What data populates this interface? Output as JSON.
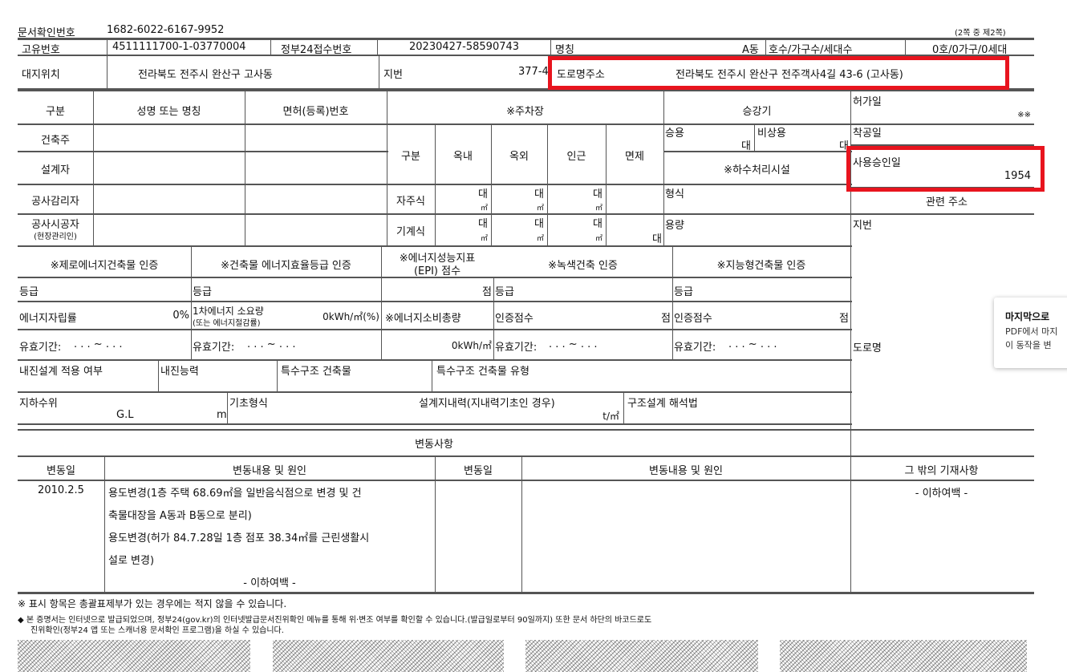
{
  "doc": {
    "doc_number_label": "문서확인번호",
    "doc_number": "1682-6022-6167-9952",
    "page_info": "(2쪽 중 제2쪽)"
  },
  "row1": {
    "unique_label": "고유번호",
    "unique_value": "4511111700-1-03770004",
    "gov24_label": "정부24접수번호",
    "gov24_value": "20230427-58590743",
    "name_label": "명칭",
    "name_value": "A동",
    "unit_label": "호수/가구수/세대수",
    "unit_value": "0호/0가구/0세대"
  },
  "row2": {
    "site_label": "대지위치",
    "site_value": "전라북도 전주시 완산구 고사동",
    "lot_label": "지번",
    "lot_value": "377-4",
    "road_label": "도로명주소",
    "road_value": "전라북도 전주시 완산구 전주객사4길 43-6 (고사동)"
  },
  "people": {
    "col_category": "구분",
    "col_name": "성명 또는 명칭",
    "col_license": "면허(등록)번호",
    "rows": [
      "건축주",
      "설계자",
      "공사감리자"
    ],
    "contractor_label": "공사시공자",
    "contractor_sub": "(현장관리인)"
  },
  "parking": {
    "title": "※주차장",
    "col_category": "구분",
    "col_indoor": "옥내",
    "col_outdoor": "옥외",
    "col_nearby": "인근",
    "col_exempt": "면제",
    "self_label": "자주식",
    "mech_label": "기계식",
    "unit_dae": "대",
    "unit_m2": "㎡"
  },
  "elevator": {
    "title": "승강기",
    "passenger": "승용",
    "emergency": "비상용",
    "unit_dae": "대",
    "sewage_title": "※하수처리시설",
    "type_label": "형식",
    "capacity_label": "용량"
  },
  "dates": {
    "permit_label": "허가일",
    "permit_value": "※※",
    "start_label": "착공일",
    "approval_label": "사용승인일",
    "approval_value": "1954",
    "related_title": "관련 주소",
    "lot_label": "지번",
    "road_label": "도로명"
  },
  "certs": {
    "zero_energy": "※제로에너지건축물 인증",
    "efficiency": "※건축물 에너지효율등급 인증",
    "epi_line1": "※에너지성능지표",
    "epi_line2": "(EPI) 점수",
    "green": "※녹색건축 인증",
    "smart": "※지능형건축물 인증",
    "grade": "등급",
    "self_sufficiency": "에너지자립률",
    "percent_zero": "0%",
    "primary_line1": "1차에너지 소요량",
    "primary_line2": "(또는 에너지절감률)",
    "primary_value": "0kWh/㎡(%)",
    "energy_total": "※에너지소비총량",
    "energy_total_value": "0kWh/㎡",
    "score": "점",
    "cert_score": "인증점수",
    "validity": "유효기간:",
    "validity_dots": ". . . ~ . . ."
  },
  "seismic": {
    "applied": "내진설계 적용 여부",
    "capacity": "내진능력",
    "special": "특수구조 건축물",
    "special_type": "특수구조 건축물 유형",
    "groundwater": "지하수위",
    "gl": "G.L",
    "unit_m": "m",
    "foundation": "기초형식",
    "bearing": "설계지내력(지내력기초인 경우)",
    "bearing_unit": "t/㎡",
    "analysis": "구조설계 해석법"
  },
  "changes": {
    "title": "변동사항",
    "col_date": "변동일",
    "col_content": "변동내용 및 원인",
    "col_other": "그 밖의 기재사항",
    "entry_date": "2010.2.5",
    "lines": [
      "용도변경(1층 주택 68.69㎡을 일반음식점으로 변경 및 건",
      "축물대장을 A동과 B동으로 분리)",
      "용도변경(허가 84.7.28일 1층 점포 38.34㎡를 근린생활시",
      "설로 변경)"
    ],
    "blank_end": "- 이하여백 -"
  },
  "notes": {
    "note1": "※ 표시 항목은 총괄표제부가 있는 경우에는 적지 않을 수 있습니다.",
    "note2": "◆ 본 증명서는 인터넷으로 발급되었으며, 정부24(gov.kr)의 인터넷발급문서진위확인 메뉴를 통해 위·변조 여부를 확인할 수 있습니다.(발급일로부터 90일까지) 또한 문서 하단의 바코드로도",
    "note3": "진위확인(정부24 앱 또는 스캐너용 문서확인 프로그램)을 하실 수 있습니다."
  },
  "tooltip": {
    "title": "마지막으로",
    "line1": "PDF에서 마지",
    "line2": "이 동작을 변"
  },
  "colors": {
    "highlight": "#e8141e",
    "line": "#555555"
  }
}
